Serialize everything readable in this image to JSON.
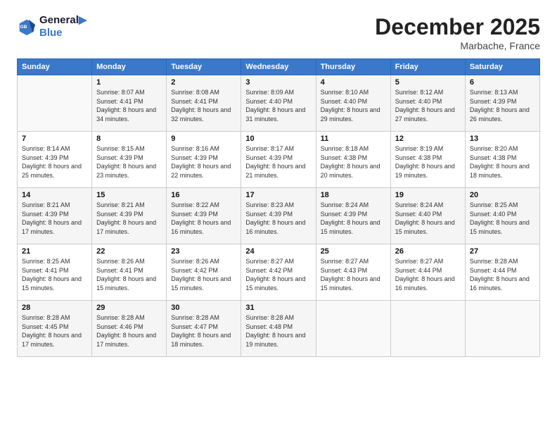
{
  "logo": {
    "line1": "General",
    "line2": "Blue"
  },
  "header": {
    "month": "December 2025",
    "location": "Marbache, France"
  },
  "columns": [
    "Sunday",
    "Monday",
    "Tuesday",
    "Wednesday",
    "Thursday",
    "Friday",
    "Saturday"
  ],
  "weeks": [
    [
      {
        "day": "",
        "sunrise": "",
        "sunset": "",
        "daylight": ""
      },
      {
        "day": "1",
        "sunrise": "Sunrise: 8:07 AM",
        "sunset": "Sunset: 4:41 PM",
        "daylight": "Daylight: 8 hours and 34 minutes."
      },
      {
        "day": "2",
        "sunrise": "Sunrise: 8:08 AM",
        "sunset": "Sunset: 4:41 PM",
        "daylight": "Daylight: 8 hours and 32 minutes."
      },
      {
        "day": "3",
        "sunrise": "Sunrise: 8:09 AM",
        "sunset": "Sunset: 4:40 PM",
        "daylight": "Daylight: 8 hours and 31 minutes."
      },
      {
        "day": "4",
        "sunrise": "Sunrise: 8:10 AM",
        "sunset": "Sunset: 4:40 PM",
        "daylight": "Daylight: 8 hours and 29 minutes."
      },
      {
        "day": "5",
        "sunrise": "Sunrise: 8:12 AM",
        "sunset": "Sunset: 4:40 PM",
        "daylight": "Daylight: 8 hours and 27 minutes."
      },
      {
        "day": "6",
        "sunrise": "Sunrise: 8:13 AM",
        "sunset": "Sunset: 4:39 PM",
        "daylight": "Daylight: 8 hours and 26 minutes."
      }
    ],
    [
      {
        "day": "7",
        "sunrise": "Sunrise: 8:14 AM",
        "sunset": "Sunset: 4:39 PM",
        "daylight": "Daylight: 8 hours and 25 minutes."
      },
      {
        "day": "8",
        "sunrise": "Sunrise: 8:15 AM",
        "sunset": "Sunset: 4:39 PM",
        "daylight": "Daylight: 8 hours and 23 minutes."
      },
      {
        "day": "9",
        "sunrise": "Sunrise: 8:16 AM",
        "sunset": "Sunset: 4:39 PM",
        "daylight": "Daylight: 8 hours and 22 minutes."
      },
      {
        "day": "10",
        "sunrise": "Sunrise: 8:17 AM",
        "sunset": "Sunset: 4:39 PM",
        "daylight": "Daylight: 8 hours and 21 minutes."
      },
      {
        "day": "11",
        "sunrise": "Sunrise: 8:18 AM",
        "sunset": "Sunset: 4:38 PM",
        "daylight": "Daylight: 8 hours and 20 minutes."
      },
      {
        "day": "12",
        "sunrise": "Sunrise: 8:19 AM",
        "sunset": "Sunset: 4:38 PM",
        "daylight": "Daylight: 8 hours and 19 minutes."
      },
      {
        "day": "13",
        "sunrise": "Sunrise: 8:20 AM",
        "sunset": "Sunset: 4:38 PM",
        "daylight": "Daylight: 8 hours and 18 minutes."
      }
    ],
    [
      {
        "day": "14",
        "sunrise": "Sunrise: 8:21 AM",
        "sunset": "Sunset: 4:39 PM",
        "daylight": "Daylight: 8 hours and 17 minutes."
      },
      {
        "day": "15",
        "sunrise": "Sunrise: 8:21 AM",
        "sunset": "Sunset: 4:39 PM",
        "daylight": "Daylight: 8 hours and 17 minutes."
      },
      {
        "day": "16",
        "sunrise": "Sunrise: 8:22 AM",
        "sunset": "Sunset: 4:39 PM",
        "daylight": "Daylight: 8 hours and 16 minutes."
      },
      {
        "day": "17",
        "sunrise": "Sunrise: 8:23 AM",
        "sunset": "Sunset: 4:39 PM",
        "daylight": "Daylight: 8 hours and 16 minutes."
      },
      {
        "day": "18",
        "sunrise": "Sunrise: 8:24 AM",
        "sunset": "Sunset: 4:39 PM",
        "daylight": "Daylight: 8 hours and 15 minutes."
      },
      {
        "day": "19",
        "sunrise": "Sunrise: 8:24 AM",
        "sunset": "Sunset: 4:40 PM",
        "daylight": "Daylight: 8 hours and 15 minutes."
      },
      {
        "day": "20",
        "sunrise": "Sunrise: 8:25 AM",
        "sunset": "Sunset: 4:40 PM",
        "daylight": "Daylight: 8 hours and 15 minutes."
      }
    ],
    [
      {
        "day": "21",
        "sunrise": "Sunrise: 8:25 AM",
        "sunset": "Sunset: 4:41 PM",
        "daylight": "Daylight: 8 hours and 15 minutes."
      },
      {
        "day": "22",
        "sunrise": "Sunrise: 8:26 AM",
        "sunset": "Sunset: 4:41 PM",
        "daylight": "Daylight: 8 hours and 15 minutes."
      },
      {
        "day": "23",
        "sunrise": "Sunrise: 8:26 AM",
        "sunset": "Sunset: 4:42 PM",
        "daylight": "Daylight: 8 hours and 15 minutes."
      },
      {
        "day": "24",
        "sunrise": "Sunrise: 8:27 AM",
        "sunset": "Sunset: 4:42 PM",
        "daylight": "Daylight: 8 hours and 15 minutes."
      },
      {
        "day": "25",
        "sunrise": "Sunrise: 8:27 AM",
        "sunset": "Sunset: 4:43 PM",
        "daylight": "Daylight: 8 hours and 15 minutes."
      },
      {
        "day": "26",
        "sunrise": "Sunrise: 8:27 AM",
        "sunset": "Sunset: 4:44 PM",
        "daylight": "Daylight: 8 hours and 16 minutes."
      },
      {
        "day": "27",
        "sunrise": "Sunrise: 8:28 AM",
        "sunset": "Sunset: 4:44 PM",
        "daylight": "Daylight: 8 hours and 16 minutes."
      }
    ],
    [
      {
        "day": "28",
        "sunrise": "Sunrise: 8:28 AM",
        "sunset": "Sunset: 4:45 PM",
        "daylight": "Daylight: 8 hours and 17 minutes."
      },
      {
        "day": "29",
        "sunrise": "Sunrise: 8:28 AM",
        "sunset": "Sunset: 4:46 PM",
        "daylight": "Daylight: 8 hours and 17 minutes."
      },
      {
        "day": "30",
        "sunrise": "Sunrise: 8:28 AM",
        "sunset": "Sunset: 4:47 PM",
        "daylight": "Daylight: 8 hours and 18 minutes."
      },
      {
        "day": "31",
        "sunrise": "Sunrise: 8:28 AM",
        "sunset": "Sunset: 4:48 PM",
        "daylight": "Daylight: 8 hours and 19 minutes."
      },
      {
        "day": "",
        "sunrise": "",
        "sunset": "",
        "daylight": ""
      },
      {
        "day": "",
        "sunrise": "",
        "sunset": "",
        "daylight": ""
      },
      {
        "day": "",
        "sunrise": "",
        "sunset": "",
        "daylight": ""
      }
    ]
  ]
}
